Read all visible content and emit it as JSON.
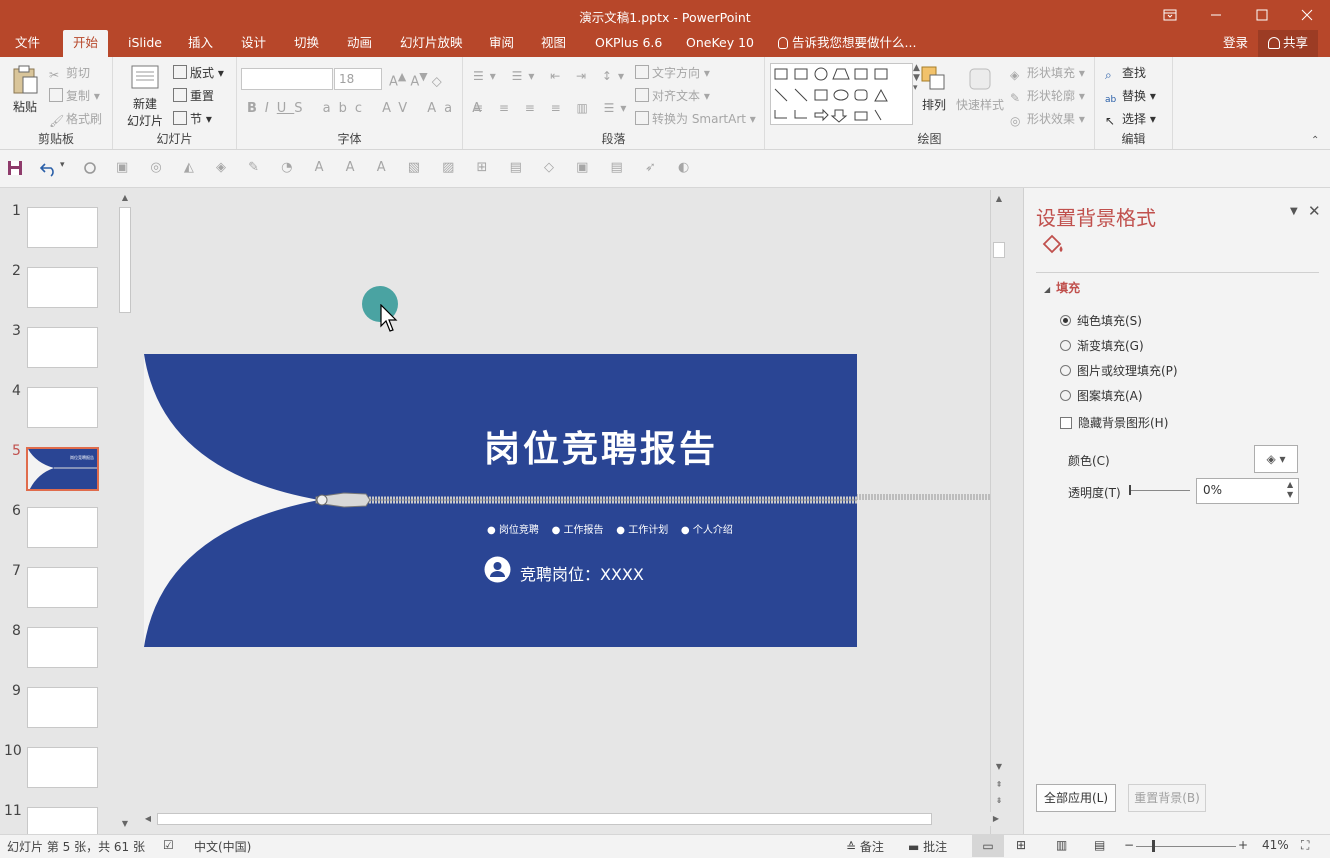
{
  "titlebar": {
    "title": "演示文稿1.pptx - PowerPoint"
  },
  "tabs": {
    "items": [
      "文件",
      "开始",
      "iSlide",
      "插入",
      "设计",
      "切换",
      "动画",
      "幻灯片放映",
      "审阅",
      "视图",
      "OKPlus 6.6",
      "OneKey 10"
    ],
    "tell_me": "告诉我您想要做什么...",
    "login": "登录",
    "share": "共享"
  },
  "ribbon": {
    "clipboard": {
      "label": "剪贴板",
      "paste": "粘贴",
      "cut": "剪切",
      "copy": "复制",
      "format_painter": "格式刷"
    },
    "slides": {
      "label": "幻灯片",
      "new_slide_1": "新建",
      "new_slide_2": "幻灯片",
      "layout": "版式",
      "reset": "重置",
      "section": "节"
    },
    "font": {
      "label": "字体",
      "font_size": "18"
    },
    "paragraph": {
      "label": "段落",
      "text_direction": "文字方向",
      "align_text": "对齐文本",
      "smartart": "转换为 SmartArt"
    },
    "drawing": {
      "label": "绘图",
      "arrange": "排列",
      "quick_styles": "快速样式",
      "shape_fill": "形状填充",
      "shape_outline": "形状轮廓",
      "shape_effects": "形状效果"
    },
    "editing": {
      "label": "编辑",
      "find": "查找",
      "replace": "替换",
      "select": "选择"
    }
  },
  "thumbnails": {
    "numbers": [
      "1",
      "2",
      "3",
      "4",
      "5",
      "6",
      "7",
      "8",
      "9",
      "10",
      "11"
    ],
    "selected": "5"
  },
  "slide": {
    "title": "岗位竞聘报告",
    "bullets": [
      "岗位竞聘",
      "工作报告",
      "工作计划",
      "个人介绍"
    ],
    "position_text": "竞聘岗位：XXXX",
    "thumb_title": "岗位竞聘报告"
  },
  "format_pane": {
    "title": "设置背景格式",
    "section": "填充",
    "options": [
      "纯色填充(S)",
      "渐变填充(G)",
      "图片或纹理填充(P)",
      "图案填充(A)"
    ],
    "selected_option": "纯色填充(S)",
    "hide_bg": "隐藏背景图形(H)",
    "color_label": "颜色(C)",
    "transparency_label": "透明度(T)",
    "transparency_value": "0%",
    "apply_all": "全部应用(L)",
    "reset_bg": "重置背景(B)"
  },
  "statusbar": {
    "slide_info": "幻灯片 第 5 张，共 61 张",
    "language": "中文(中国)",
    "notes": "备注",
    "comments": "批注",
    "zoom": "41%"
  },
  "colors": {
    "accent": "#b7472a",
    "slide_bg": "#2a4594",
    "pointer_circle": "#4aa3a2"
  }
}
